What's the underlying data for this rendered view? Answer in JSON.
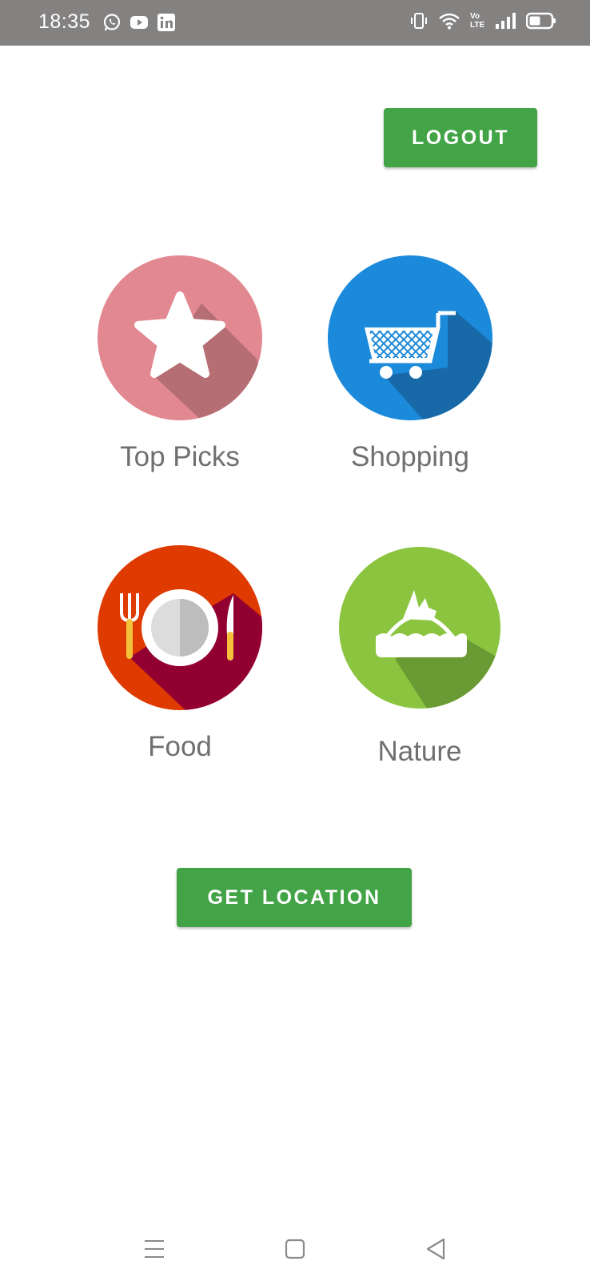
{
  "status_bar": {
    "time": "18:35",
    "left_icons": [
      "whatsapp-icon",
      "youtube-icon",
      "linkedin-icon"
    ],
    "right_icons": [
      "vibrate-icon",
      "wifi-icon",
      "volte-icon",
      "signal-icon",
      "battery-icon"
    ],
    "volte_text": "Vo LTE"
  },
  "header": {
    "logout_label": "LOGOUT"
  },
  "categories": [
    {
      "label": "Top Picks",
      "icon": "star-icon",
      "color": "#e28891"
    },
    {
      "label": "Shopping",
      "icon": "shopping-cart-icon",
      "color": "#1c8adb"
    },
    {
      "label": "Food",
      "icon": "plate-cutlery-icon",
      "color": "#df3a00"
    },
    {
      "label": "Nature",
      "icon": "island-icon",
      "color": "#8bc53f"
    }
  ],
  "actions": {
    "get_location_label": "GET LOCATION"
  },
  "colors": {
    "button": "#43a447",
    "status_bar": "#848181",
    "label_text": "#6f6f6f"
  },
  "nav_bar": [
    "menu-icon",
    "home-icon",
    "back-icon"
  ]
}
